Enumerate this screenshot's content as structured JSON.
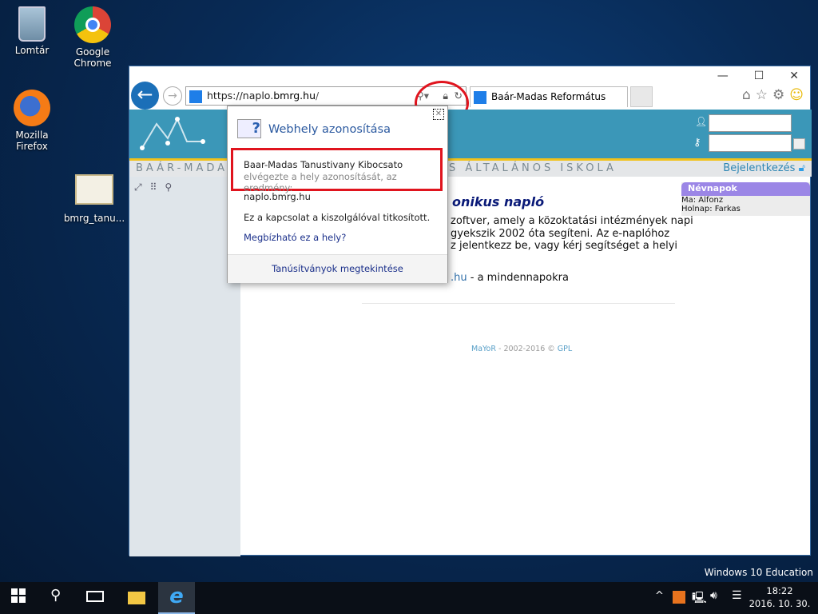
{
  "desktop": {
    "icons": [
      {
        "label": "Lomtár"
      },
      {
        "label": "Google Chrome"
      },
      {
        "label": "Mozilla Firefox"
      },
      {
        "label": "bmrg_tanu..."
      }
    ],
    "watermark": "Windows 10 Education"
  },
  "browser": {
    "url_prefix": "https://naplo.",
    "url_domain": "bmrg.hu",
    "url_suffix": "/",
    "tab_title": "Baár-Madas Református Gi...",
    "min": "—",
    "max": "☐",
    "close": "✕"
  },
  "page": {
    "school_name": "BAÁR-MADAS",
    "school_name_right": "S ÁLTALÁNOS ISKOLA",
    "login_link": "Bejelentkezés",
    "title_fragment": "onikus napló",
    "body_lines": [
      "zoftver, amely a közoktatási intézmények napi",
      "gyekszik 2002 óta segíteni. Az e-naplóhoz",
      "z jelentkezz be, vagy kérj segítséget a helyi"
    ],
    "link_fragment": ".hu",
    "link_after": " - a mindennapokra",
    "footer": {
      "mayor": "MaYoR",
      "years": " - 2002-2016 © ",
      "gpl": "GPL"
    },
    "nevnapok": {
      "title": "Névnapok",
      "today": "Ma: Alfonz",
      "tomorrow": "Holnap: Farkas"
    }
  },
  "popup": {
    "title": "Webhely azonosítása",
    "issuer": "Baar-Madas Tanustivany Kibocsato",
    "issuer_note": "elvégezte a hely azonosítását, az eredmény:",
    "host": "naplo.bmrg.hu",
    "encrypted": "Ez a kapcsolat a kiszolgálóval titkosított.",
    "trust_link": "Megbízható ez a hely?",
    "view_certs": "Tanúsítványok megtekintése"
  },
  "taskbar": {
    "time": "18:22",
    "date": "2016. 10. 30."
  },
  "colors": {
    "annotation": "#e0141e",
    "banner": "#3b97b8",
    "accent": "#f1c21b"
  }
}
